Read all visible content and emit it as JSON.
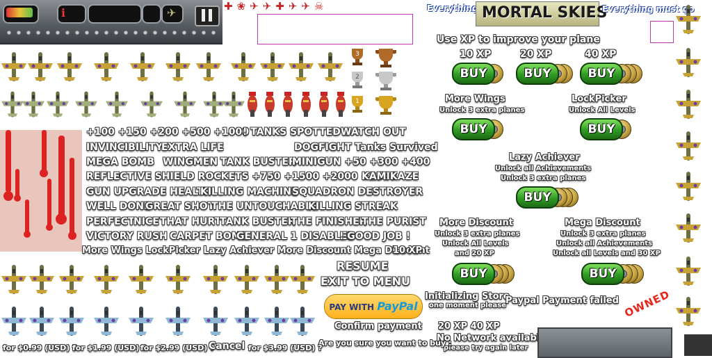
{
  "title": {
    "left_tag": "Everything must go",
    "main": "MORTAL SKIES",
    "right_tag": "Everything must go"
  },
  "store": {
    "intro": "Use XP to improve your plane",
    "tiers": [
      "10 XP",
      "20 XP",
      "40 XP"
    ],
    "buy_label": "BUY",
    "more_wings": {
      "name": "More Wings",
      "desc": "Unlock 3 extra planes"
    },
    "lockpicker": {
      "name": "LockPicker",
      "desc": "Unlock All Levels"
    },
    "lazy": {
      "name": "Lazy Achiever",
      "desc1": "Unlock all Achievements",
      "desc2": "Unlock 3 extra planes"
    },
    "more_discount": {
      "name": "More Discount",
      "desc1": "Unlock 3 extra planes",
      "desc2": "Unlock All Levels",
      "desc3": "and 20 XP"
    },
    "mega_discount": {
      "name": "Mega Discount",
      "desc1": "Unlock 3 extra planes",
      "desc2": "Unlock all Achievements",
      "desc3": "Unlock all Levels and 30 XP"
    }
  },
  "messages": [
    "+100 +150 +200 +500 +1000",
    "! TANKS SPOTTED !",
    "WATCH OUT",
    "INVINCIBILITY",
    "EXTRA LIFE",
    "DOGFIGHT Tanks Survived",
    "MEGA BOMB",
    "WINGMEN",
    "TANK BUSTER",
    "MINIGUN +50 +300 +400",
    "REFLECTIVE SHIELD ROCKETS +750 +1500 +2000 +2500",
    "KAMIKAZE",
    "GUN UPGRADE HEALTH",
    "KILLING MACHINE",
    "SQUADRON DESTROYER",
    "WELL DONE",
    "GREAT SHOT",
    "THE UNTOUCHABLE",
    "KILLING STREAK",
    "PERFECT",
    "NICE",
    "THAT HURT",
    "TANK BUSTER",
    "THE FINISHER",
    "THE PURIST",
    "VICTORY RUSH",
    "CARPET BOMB",
    "GENERAL 1 DISABLED",
    "! GOOD JOB !",
    "More Wings LockPicker Lazy Achiever More Discount Mega Discount",
    "10 XP"
  ],
  "menu": {
    "resume": "RESUME",
    "exit": "EXIT TO MENU"
  },
  "payment": {
    "paypal_with": "PAY WITH",
    "paypal_brand": "PayPal",
    "initializing": "Initializing Store",
    "one_moment": "one moment please",
    "failed": "Paypal Payment failed",
    "confirm": "Confirm payment",
    "xp_pair": "20 XP 40 XP",
    "no_network": "No Network available",
    "try_later": "please try again later",
    "are_you_sure": "Are you sure you want to buy :",
    "owned": "OWNED",
    "prices": [
      "for $0.99 (USD) ?",
      "for $1.99 (USD) ?",
      "for $2.99 (USD) ?",
      "Cancel",
      "for $3.99 (USD) ?"
    ]
  },
  "trophy_ranks": [
    "3",
    "2",
    "1"
  ],
  "colors": {
    "gold": "#d9a520",
    "silver": "#c8c8c8",
    "bronze": "#b06a2a",
    "buy_green": "#2f9b23",
    "owned_red": "#e8251a"
  },
  "icons": [
    "pause-icon",
    "plane-icon",
    "health-icon",
    "bomb-icon",
    "trophy-icon",
    "coin-icon"
  ]
}
